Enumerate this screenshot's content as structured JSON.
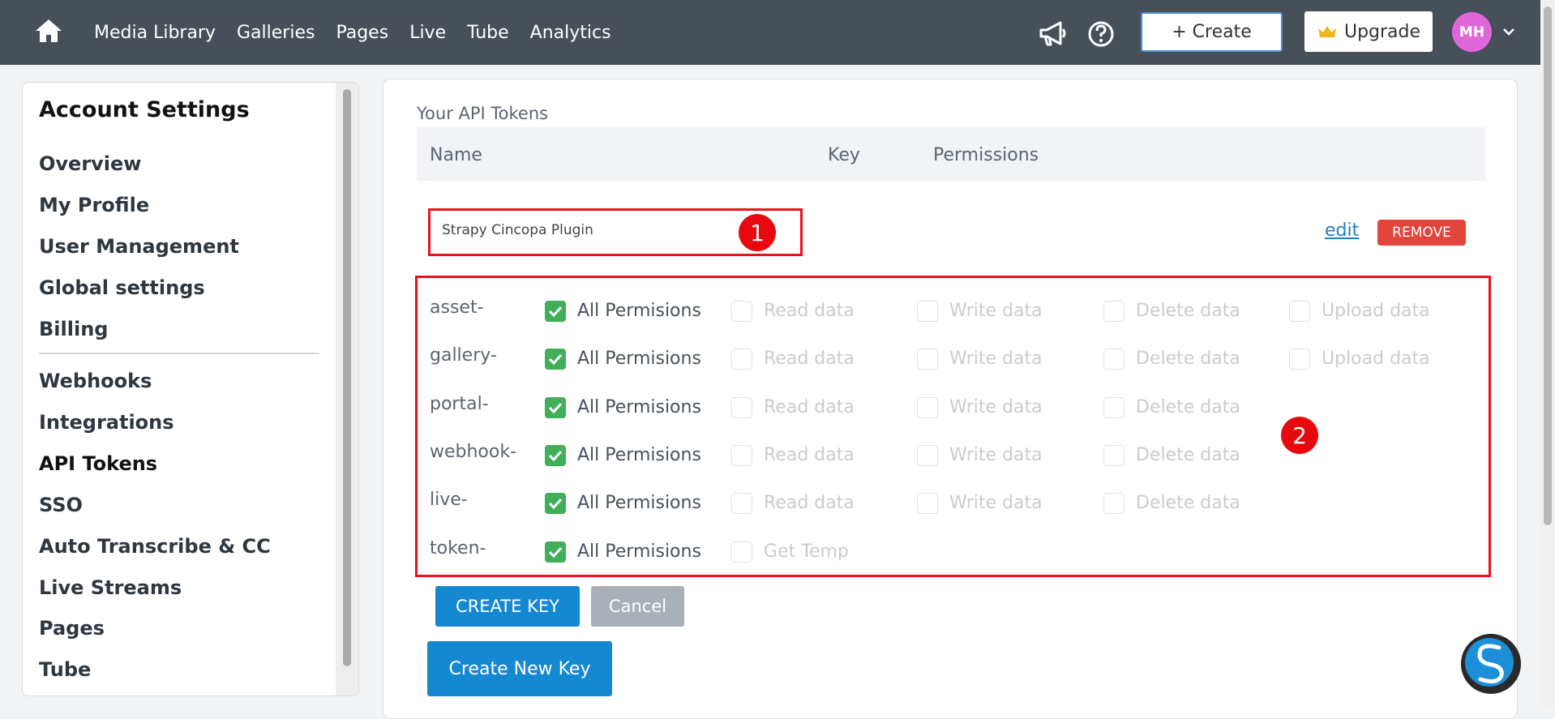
{
  "nav": {
    "items": [
      "Media Library",
      "Galleries",
      "Pages",
      "Live",
      "Tube",
      "Analytics"
    ],
    "create_label": "+ Create",
    "upgrade_label": "Upgrade",
    "avatar_initials": "MH"
  },
  "sidebar": {
    "title": "Account Settings",
    "items": [
      "Overview",
      "My Profile",
      "User Management",
      "Global settings",
      "Billing",
      "Webhooks",
      "Integrations",
      "API Tokens",
      "SSO",
      "Auto Transcribe & CC",
      "Live Streams",
      "Pages",
      "Tube"
    ],
    "active": "API Tokens"
  },
  "main": {
    "section_title": "Your API Tokens",
    "columns": [
      "Name",
      "Key",
      "Permissions"
    ],
    "token_name_value": "Strapy Cincopa Plugin",
    "edit_label": "edit",
    "remove_label": "REMOVE",
    "annotation_1": "1",
    "annotation_2": "2",
    "permissions": [
      {
        "scope": "asset-",
        "all": "All Permisions",
        "options": [
          "Read data",
          "Write data",
          "Delete data",
          "Upload data"
        ]
      },
      {
        "scope": "gallery-",
        "all": "All Permisions",
        "options": [
          "Read data",
          "Write data",
          "Delete data",
          "Upload data"
        ]
      },
      {
        "scope": "portal-",
        "all": "All Permisions",
        "options": [
          "Read data",
          "Write data",
          "Delete data"
        ]
      },
      {
        "scope": "webhook-",
        "all": "All Permisions",
        "options": [
          "Read data",
          "Write data",
          "Delete data"
        ]
      },
      {
        "scope": "live-",
        "all": "All Permisions",
        "options": [
          "Read data",
          "Write data",
          "Delete data"
        ]
      },
      {
        "scope": "token-",
        "all": "All Permisions",
        "options": [
          "Get Temp"
        ]
      }
    ],
    "create_key_label": "CREATE KEY",
    "cancel_label": "Cancel",
    "create_new_key_label": "Create New Key"
  },
  "colors": {
    "topbar": "#475059",
    "accent_blue": "#1588d2",
    "checkbox_green": "#3faf59",
    "remove_red": "#e1453c",
    "annotation_red": "#e8141c"
  }
}
